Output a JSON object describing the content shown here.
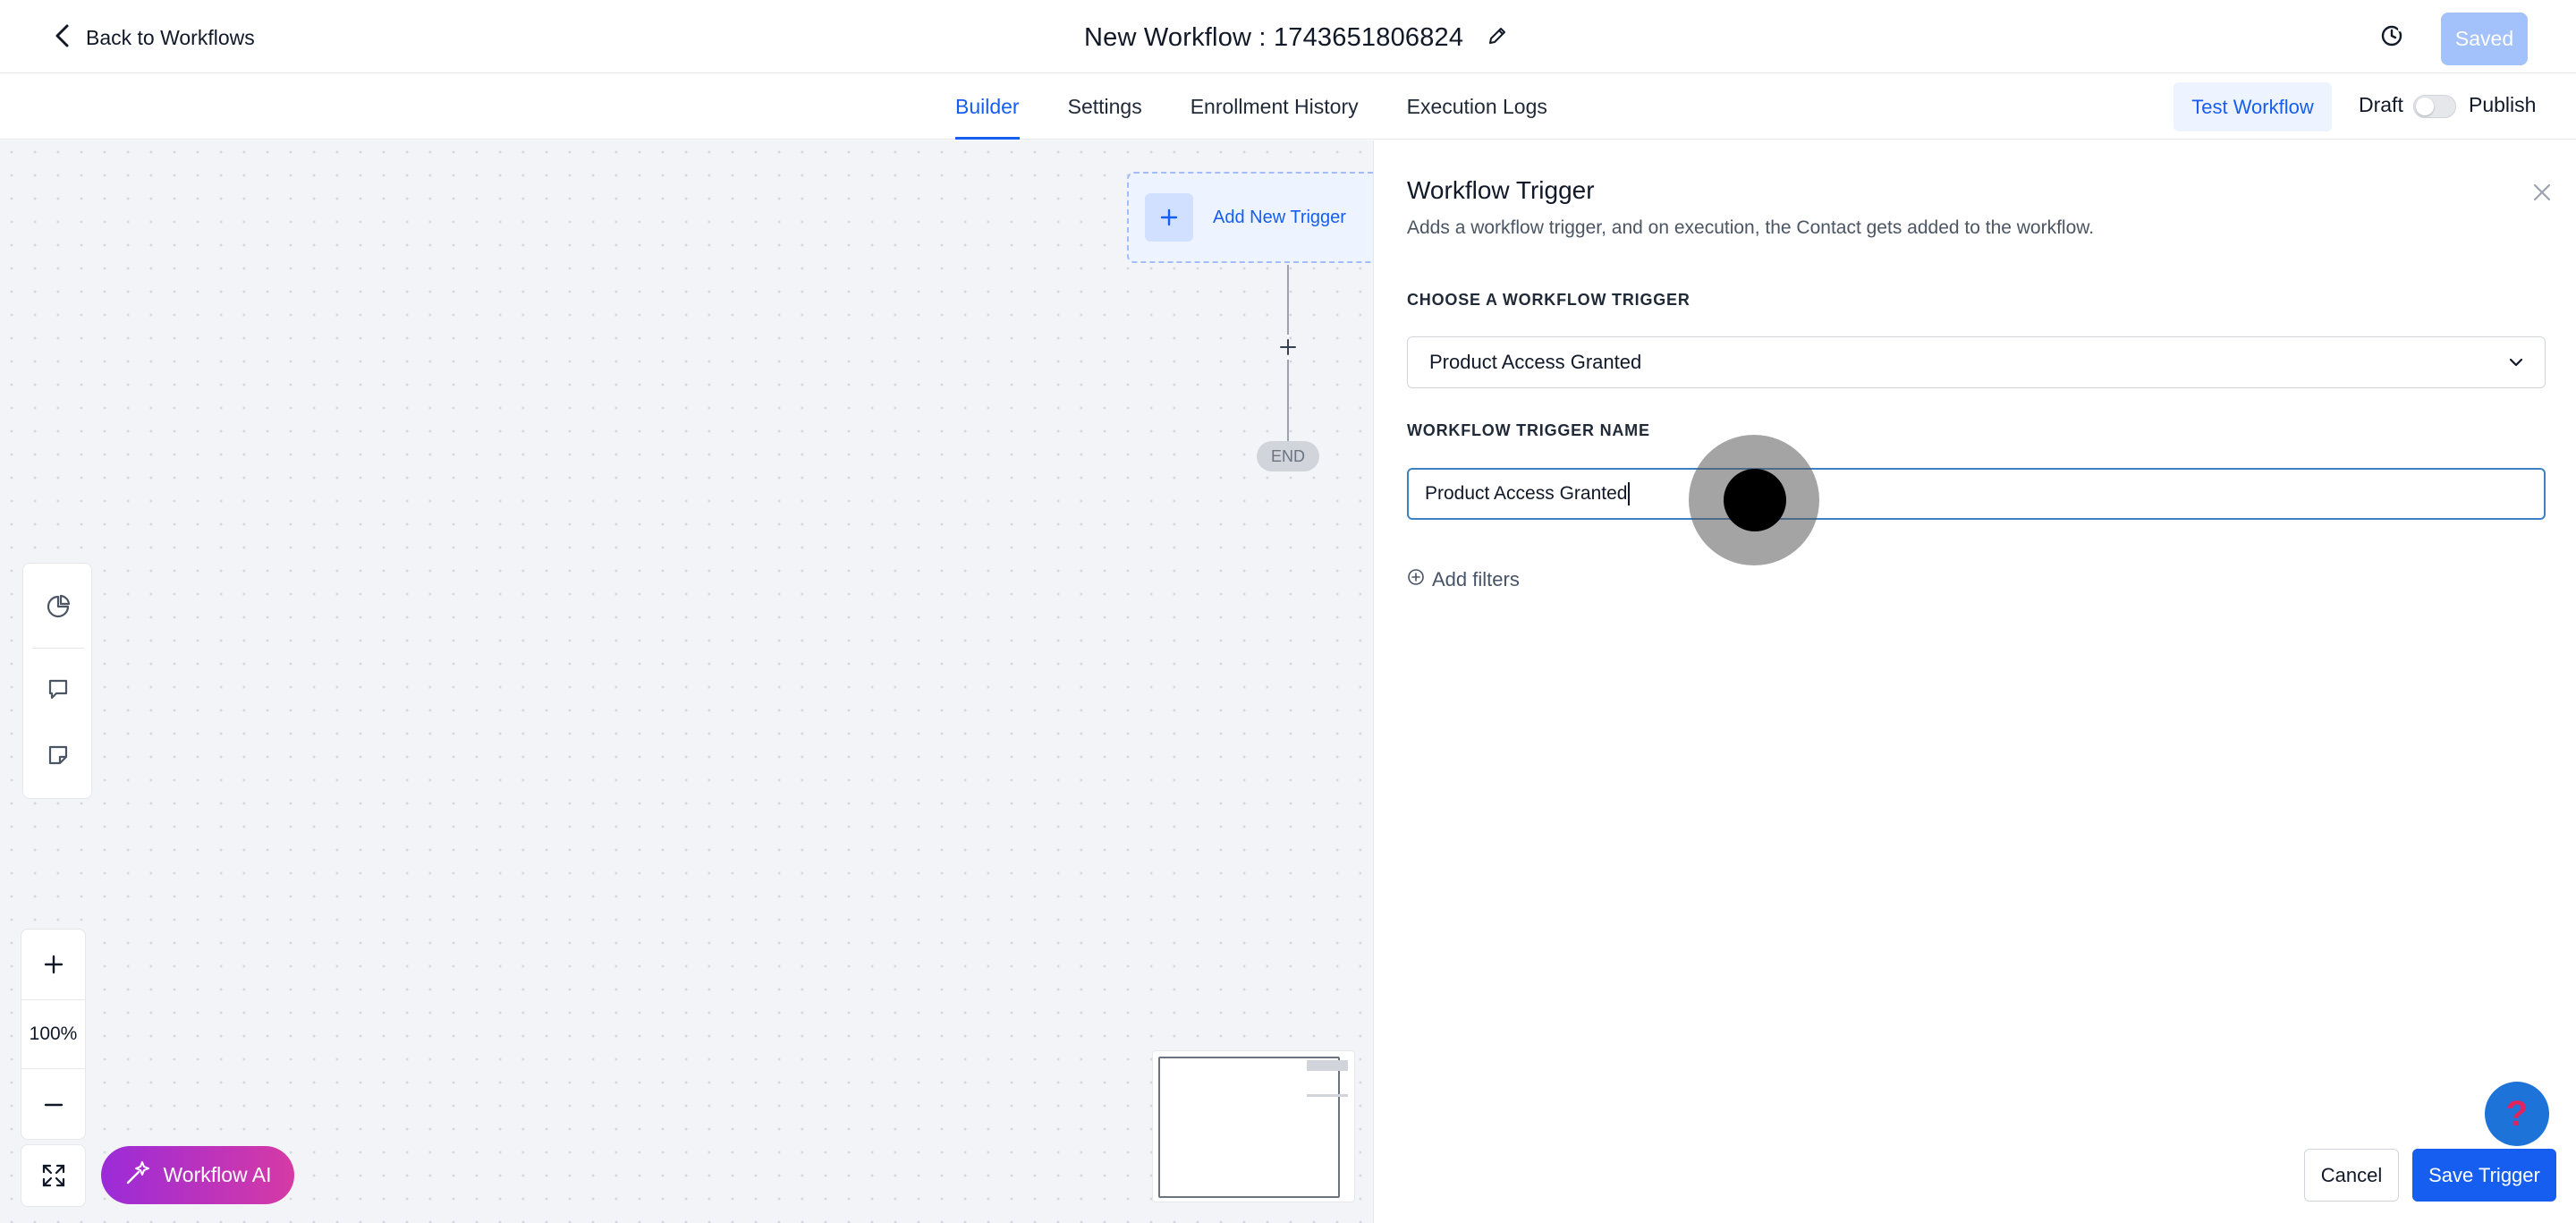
{
  "header": {
    "back_label": "Back to Workflows",
    "title": "New Workflow : 1743651806824",
    "saved_label": "Saved"
  },
  "tabs": [
    {
      "label": "Builder",
      "active": true
    },
    {
      "label": "Settings",
      "active": false
    },
    {
      "label": "Enrollment History",
      "active": false
    },
    {
      "label": "Execution Logs",
      "active": false
    }
  ],
  "actions": {
    "test_label": "Test Workflow",
    "draft_label": "Draft",
    "publish_label": "Publish",
    "publish_enabled": false
  },
  "canvas": {
    "trigger_node_label": "Add New Trigger",
    "end_label": "END",
    "zoom_level": "100%",
    "ai_button_label": "Workflow AI"
  },
  "panel": {
    "title": "Workflow Trigger",
    "description": "Adds a workflow trigger, and on execution, the Contact gets added to the workflow.",
    "choose_label": "CHOOSE A WORKFLOW TRIGGER",
    "selected_trigger": "Product Access Granted",
    "name_label": "WORKFLOW TRIGGER NAME",
    "name_value": "Product Access Granted",
    "add_filters_label": "Add filters",
    "cancel_label": "Cancel",
    "save_label": "Save Trigger"
  },
  "help_icon": "?",
  "colors": {
    "accent": "#155eef",
    "saved_disabled": "#a3c1fb",
    "ai_gradient_start": "#9b2bd8",
    "ai_gradient_end": "#d63aa5",
    "help_button": "#1e73d8"
  }
}
